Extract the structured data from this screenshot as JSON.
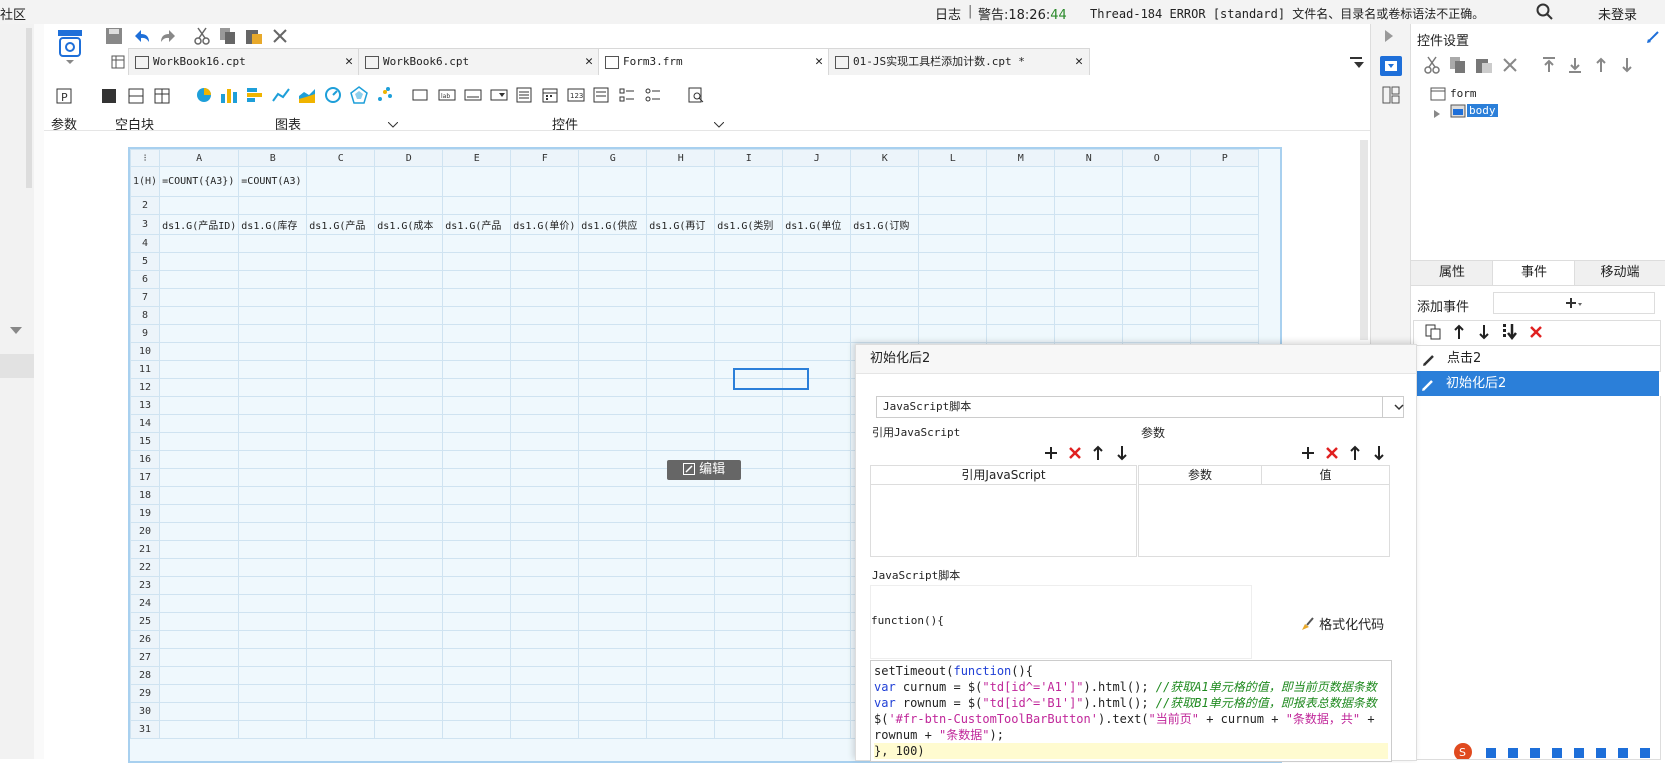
{
  "topbar": {
    "left_fragment": "社区",
    "log_label": "日志",
    "warning_prefix": "警告:18:26:",
    "warning_sec": "44",
    "warning_msg": "Thread-184 ERROR [standard] 文件名、目录名或卷标语法不正确。",
    "login": "未登录"
  },
  "tabs": [
    {
      "name": "WorkBook16.cpt"
    },
    {
      "name": "WorkBook6.cpt"
    },
    {
      "name": "Form3.frm"
    },
    {
      "name": "01-JS实现工具栏添加计数.cpt *"
    }
  ],
  "tab_close": "✕",
  "toolbar": {
    "param_label": "参数",
    "blank_label": "空白块",
    "chart_label": "图表",
    "widget_label": "控件"
  },
  "sheet": {
    "columns": [
      "A",
      "B",
      "C",
      "D",
      "E",
      "F",
      "G",
      "H",
      "I",
      "J",
      "K",
      "L",
      "M",
      "N",
      "O",
      "P"
    ],
    "row1_label": "1(H)",
    "row1": [
      "=COUNT({A3})",
      "=COUNT(A3)"
    ],
    "row3": [
      "ds1.G(产品ID)",
      "ds1.G(库存",
      "ds1.G(产品",
      "ds1.G(成本",
      "ds1.G(产品",
      "ds1.G(单价)",
      "ds1.G(供应",
      "ds1.G(再订",
      "ds1.G(类别",
      "ds1.G(单位",
      "ds1.G(订购"
    ],
    "row_count": 31
  },
  "edit_button": "编辑",
  "right_panel": {
    "title": "控件设置",
    "tree_root": "form",
    "tree_child": "body",
    "tabs": [
      "属性",
      "事件",
      "移动端"
    ],
    "add_event": "添加事件",
    "events": [
      "点击2",
      "初始化后2"
    ]
  },
  "dialog": {
    "title": "初始化后2",
    "script_type": "JavaScript脚本",
    "ref_js_label": "引用JavaScript",
    "param_label": "参数",
    "ref_js_header": "引用JavaScript",
    "param_header": "参数",
    "value_header": "值",
    "js_script_label": "JavaScript脚本",
    "fn_open": "function(){",
    "format_code": "格式化代码",
    "code": {
      "l1a": "setTimeout(",
      "l1b": "function",
      "l1c": "(){",
      "l2a": "var",
      "l2b": " curnum = $(",
      "l2c": "\"td[id^='A1']\"",
      "l2d": ").html(); ",
      "l2e": "//获取A1单元格的值，即当前页数据条数",
      "l3a": "var",
      "l3b": " rownum = $(",
      "l3c": "\"td[id^='B1']\"",
      "l3d": ").html(); ",
      "l3e": "//获取B1单元格的值，即报表总数据条数",
      "l4a": "$(",
      "l4b": "'#fr-btn-CustomToolBarButton'",
      "l4c": ").text(",
      "l4d": "\"当前页\"",
      "l4e": " + curnum + ",
      "l4f": "\"条数据，共\"",
      "l4g": " +",
      "l5a": "rownum + ",
      "l5b": "\"条数据\"",
      "l5c": ");",
      "l6": "}, 100)"
    }
  },
  "colors": {
    "accent": "#1e6fd9",
    "sheet_bg": "#eff8fd",
    "selected": "#2b7fd9"
  }
}
